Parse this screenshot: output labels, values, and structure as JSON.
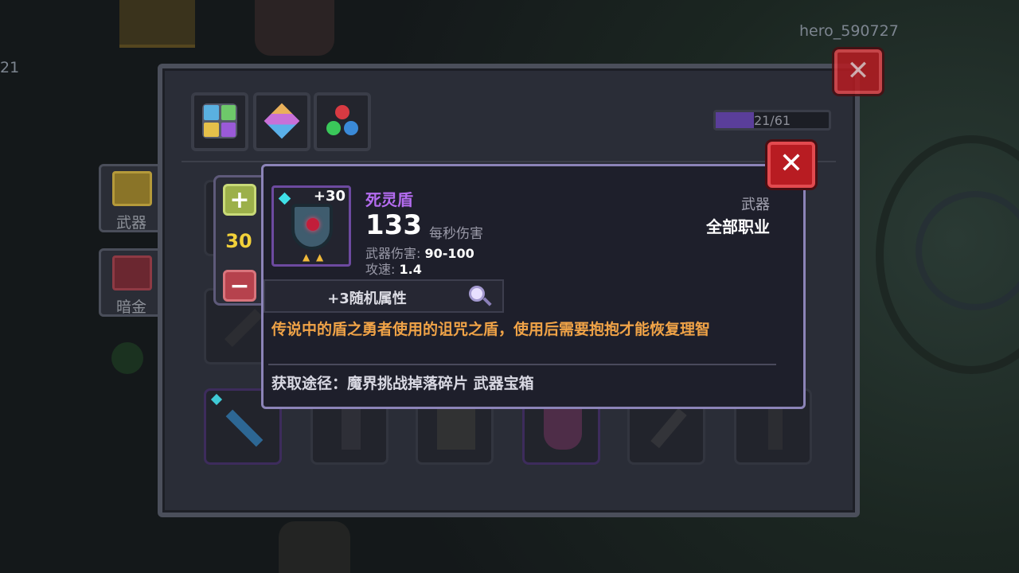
{
  "hud": {
    "player_name": "hero_590727",
    "left_number": "21"
  },
  "side_tabs": [
    {
      "label": "武器"
    },
    {
      "label": "暗金"
    }
  ],
  "inventory": {
    "capacity_text": "21/61",
    "capacity_fraction": 0.34
  },
  "stepper": {
    "plus": "+",
    "minus": "−",
    "value": "30"
  },
  "item": {
    "name": "死灵盾",
    "level_badge": "+30",
    "dps_value": "133",
    "dps_label": "每秒伤害",
    "damage_label": "武器伤害:",
    "damage_value": "90-100",
    "speed_label": "攻速:",
    "speed_value": "1.4",
    "type": "武器",
    "class": "全部职业",
    "random_attr": "+3随机属性",
    "description": "传说中的盾之勇者使用的诅咒之盾，使用后需要抱抱才能恢复理智",
    "source": "获取途径：魔界挑战掉落碎片 武器宝箱",
    "colors": {
      "name": "#b46cf0",
      "description": "#f0a347",
      "quantity": "#f2d13a"
    }
  },
  "close_glyph": "✕"
}
